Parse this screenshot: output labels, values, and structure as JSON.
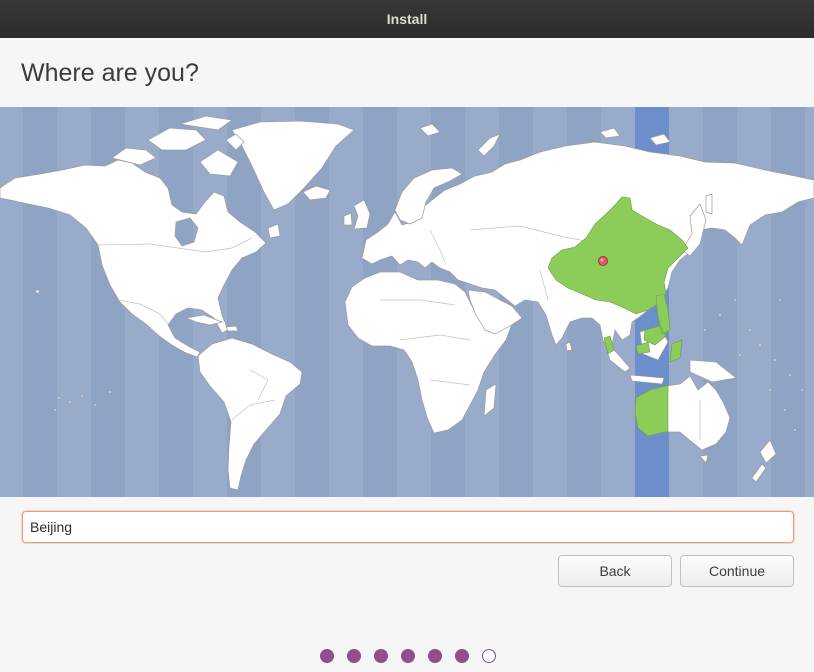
{
  "window": {
    "title": "Install"
  },
  "header": {
    "title": "Where are you?"
  },
  "map": {
    "ocean_colors": [
      "#8fa3c5",
      "#99abca"
    ],
    "selected_band_color": "#6c8fcc",
    "land_color": "#ffffff",
    "selected_region_color": "#8ccd5a",
    "pin_color": "#e35d5d"
  },
  "location_field": {
    "value": "Beijing"
  },
  "buttons": {
    "back": "Back",
    "continue": "Continue"
  },
  "progress": {
    "total_steps": 7,
    "completed_steps": 6,
    "color": "#924d8b"
  }
}
